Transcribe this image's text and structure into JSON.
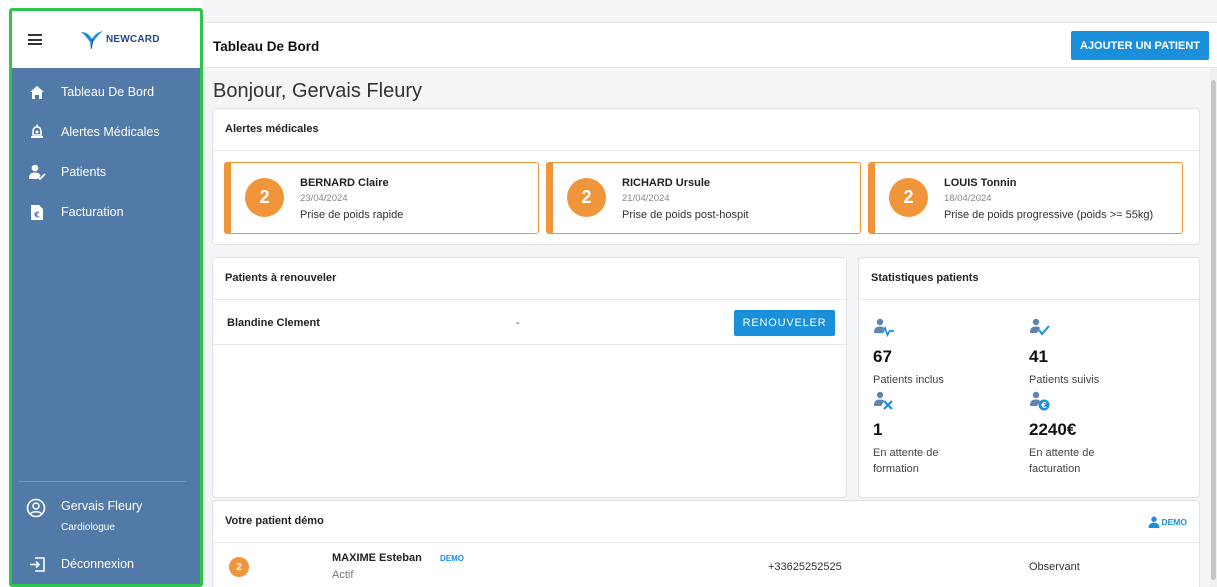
{
  "app": {
    "logo_text": "NEWCARD"
  },
  "sidebar": {
    "items": [
      {
        "label": "Tableau De Bord",
        "icon": "home-icon"
      },
      {
        "label": "Alertes Médicales",
        "icon": "alarm-bell-icon"
      },
      {
        "label": "Patients",
        "icon": "patients-icon"
      },
      {
        "label": "Facturation",
        "icon": "invoice-icon"
      }
    ],
    "user": {
      "name": "Gervais Fleury",
      "role": "Cardiologue",
      "icon": "account-circle-icon"
    },
    "logout_label": "Déconnexion"
  },
  "topbar": {
    "title": "Tableau De Bord",
    "add_patient_label": "AJOUTER UN PATIENT"
  },
  "greeting": "Bonjour, Gervais Fleury",
  "alerts": {
    "title": "Alertes médicales",
    "items": [
      {
        "count": "2",
        "name": "BERNARD Claire",
        "date": "23/04/2024",
        "description": "Prise de poids rapide"
      },
      {
        "count": "2",
        "name": "RICHARD Ursule",
        "date": "21/04/2024",
        "description": "Prise de poids post-hospit"
      },
      {
        "count": "2",
        "name": "LOUIS Tonnin",
        "date": "18/04/2024",
        "description": "Prise de poids progressive (poids >= 55kg)"
      }
    ],
    "accent": "#f0953a"
  },
  "renewals": {
    "title": "Patients à renouveler",
    "rows": [
      {
        "name": "Blandine Clement",
        "value": "-",
        "button_label": "RENOUVELER"
      }
    ]
  },
  "stats": {
    "title": "Statistiques patients",
    "items": [
      {
        "value": "67",
        "label": "Patients inclus",
        "icon": "patient-heartbeat-icon"
      },
      {
        "value": "41",
        "label": "Patients suivis",
        "icon": "patient-check-icon"
      },
      {
        "value": "1",
        "label": "En attente de formation",
        "icon": "patient-tools-icon"
      },
      {
        "value": "2240€",
        "label": "En attente de facturation",
        "icon": "patient-euro-icon"
      }
    ]
  },
  "demo": {
    "title": "Votre patient démo",
    "tag_label": "DEMO",
    "patient": {
      "count": "2",
      "name": "MAXIME Esteban",
      "badge": "DEMO",
      "status": "Actif",
      "phone": "+33625252525",
      "role": "Observant"
    }
  },
  "colors": {
    "sidebar": "#527aa8",
    "primary": "#1a8fdc",
    "highlight_frame": "#2fc44a"
  }
}
